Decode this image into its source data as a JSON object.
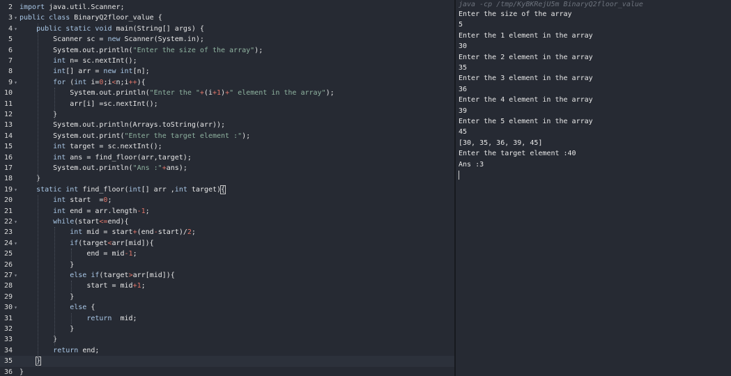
{
  "editor": {
    "lines": [
      {
        "n": "2",
        "fold": "",
        "html": "<span class=\"kw\">import</span> java.util.Scanner;"
      },
      {
        "n": "3",
        "fold": "▾",
        "html": "<span class=\"kw\">public</span> <span class=\"kw\">class</span> BinaryQ2floor_value {"
      },
      {
        "n": "4",
        "fold": "▾",
        "html": "    <span class=\"kw\">public</span> <span class=\"kw\">static</span> <span class=\"kw\">void</span> main(String[] args) {"
      },
      {
        "n": "5",
        "fold": "",
        "html": "        Scanner sc = <span class=\"kw\">new</span> Scanner(System.in);"
      },
      {
        "n": "6",
        "fold": "",
        "html": "        System.out.println(<span class=\"str\">\"Enter the size of the array\"</span>);"
      },
      {
        "n": "7",
        "fold": "",
        "html": "        <span class=\"kw\">int</span> n= sc.nextInt();"
      },
      {
        "n": "8",
        "fold": "",
        "html": "        <span class=\"kw\">int</span>[] arr = <span class=\"kw\">new</span> <span class=\"kw\">int</span>[n];"
      },
      {
        "n": "9",
        "fold": "▾",
        "html": "        <span class=\"kw\">for</span> (<span class=\"kw\">int</span> i=<span class=\"num\">0</span>;i<span class=\"op\">&lt;</span>n;i<span class=\"op\">++</span>){"
      },
      {
        "n": "10",
        "fold": "",
        "html": "            System.out.println(<span class=\"str\">\"Enter the \"</span><span class=\"op\">+</span>(i<span class=\"op\">+</span><span class=\"num\">1</span>)<span class=\"op\">+</span><span class=\"str\">\" element in the array\"</span>);"
      },
      {
        "n": "11",
        "fold": "",
        "html": "            arr[i] =sc.nextInt();"
      },
      {
        "n": "12",
        "fold": "",
        "html": "        }"
      },
      {
        "n": "13",
        "fold": "",
        "html": "        System.out.println(Arrays.toString(arr));"
      },
      {
        "n": "14",
        "fold": "",
        "html": "        System.out.print(<span class=\"str\">\"Enter the target element :\"</span>);"
      },
      {
        "n": "15",
        "fold": "",
        "html": "        <span class=\"kw\">int</span> target = sc.nextInt();"
      },
      {
        "n": "16",
        "fold": "",
        "html": "        <span class=\"kw\">int</span> ans = find_floor(arr,target);"
      },
      {
        "n": "17",
        "fold": "",
        "html": "        System.out.println(<span class=\"str\">\"Ans :\"</span><span class=\"op\">+</span>ans);"
      },
      {
        "n": "18",
        "fold": "",
        "html": "    }"
      },
      {
        "n": "19",
        "fold": "▾",
        "html": "    <span class=\"kw\">static</span> <span class=\"kw\">int</span> find_floor(<span class=\"kw\">int</span>[] arr ,<span class=\"kw\">int</span> target)<span class=\"cursor-box\">{</span>"
      },
      {
        "n": "20",
        "fold": "",
        "html": "        <span class=\"kw\">int</span> start  =<span class=\"num\">0</span>;"
      },
      {
        "n": "21",
        "fold": "",
        "html": "        <span class=\"kw\">int</span> end = arr.length<span class=\"op\">-</span><span class=\"num\">1</span>;"
      },
      {
        "n": "22",
        "fold": "▾",
        "html": "        <span class=\"kw\">while</span>(start<span class=\"op\">&lt;=</span>end){"
      },
      {
        "n": "23",
        "fold": "",
        "html": "            <span class=\"kw\">int</span> mid = start<span class=\"op\">+</span>(end<span class=\"op\">-</span>start)/<span class=\"num\">2</span>;"
      },
      {
        "n": "24",
        "fold": "▾",
        "html": "            <span class=\"kw\">if</span>(target<span class=\"op\">&lt;</span>arr[mid]){"
      },
      {
        "n": "25",
        "fold": "",
        "html": "                end = mid<span class=\"op\">-</span><span class=\"num\">1</span>;"
      },
      {
        "n": "26",
        "fold": "",
        "html": "            }"
      },
      {
        "n": "27",
        "fold": "▾",
        "html": "            <span class=\"kw\">else</span> <span class=\"kw\">if</span>(target<span class=\"op\">&gt;</span>arr[mid]){"
      },
      {
        "n": "28",
        "fold": "",
        "html": "                start = mid<span class=\"op\">+</span><span class=\"num\">1</span>;"
      },
      {
        "n": "29",
        "fold": "",
        "html": "            }"
      },
      {
        "n": "30",
        "fold": "▾",
        "html": "            <span class=\"kw\">else</span> {"
      },
      {
        "n": "31",
        "fold": "",
        "html": "                <span class=\"kw\">return</span>  mid;"
      },
      {
        "n": "32",
        "fold": "",
        "html": "            }"
      },
      {
        "n": "33",
        "fold": "",
        "html": "        }"
      },
      {
        "n": "34",
        "fold": "",
        "html": "        <span class=\"kw\">return</span> end;"
      },
      {
        "n": "35",
        "fold": "",
        "html": "    <span class=\"cursor-box\">}</span>"
      },
      {
        "n": "36",
        "fold": "",
        "html": "}"
      }
    ]
  },
  "console": {
    "command": "java -cp /tmp/KyBKRejU5m BinaryQ2floor_value",
    "lines": [
      "Enter the size of the array",
      "5",
      "Enter the 1 element in the array",
      "30",
      "Enter the 2 element in the array",
      "35",
      "Enter the 3 element in the array",
      "36",
      "Enter the 4 element in the array",
      "39",
      "Enter the 5 element in the array",
      "45",
      "[30, 35, 36, 39, 45]",
      "Enter the target element :40",
      "Ans :3"
    ]
  }
}
